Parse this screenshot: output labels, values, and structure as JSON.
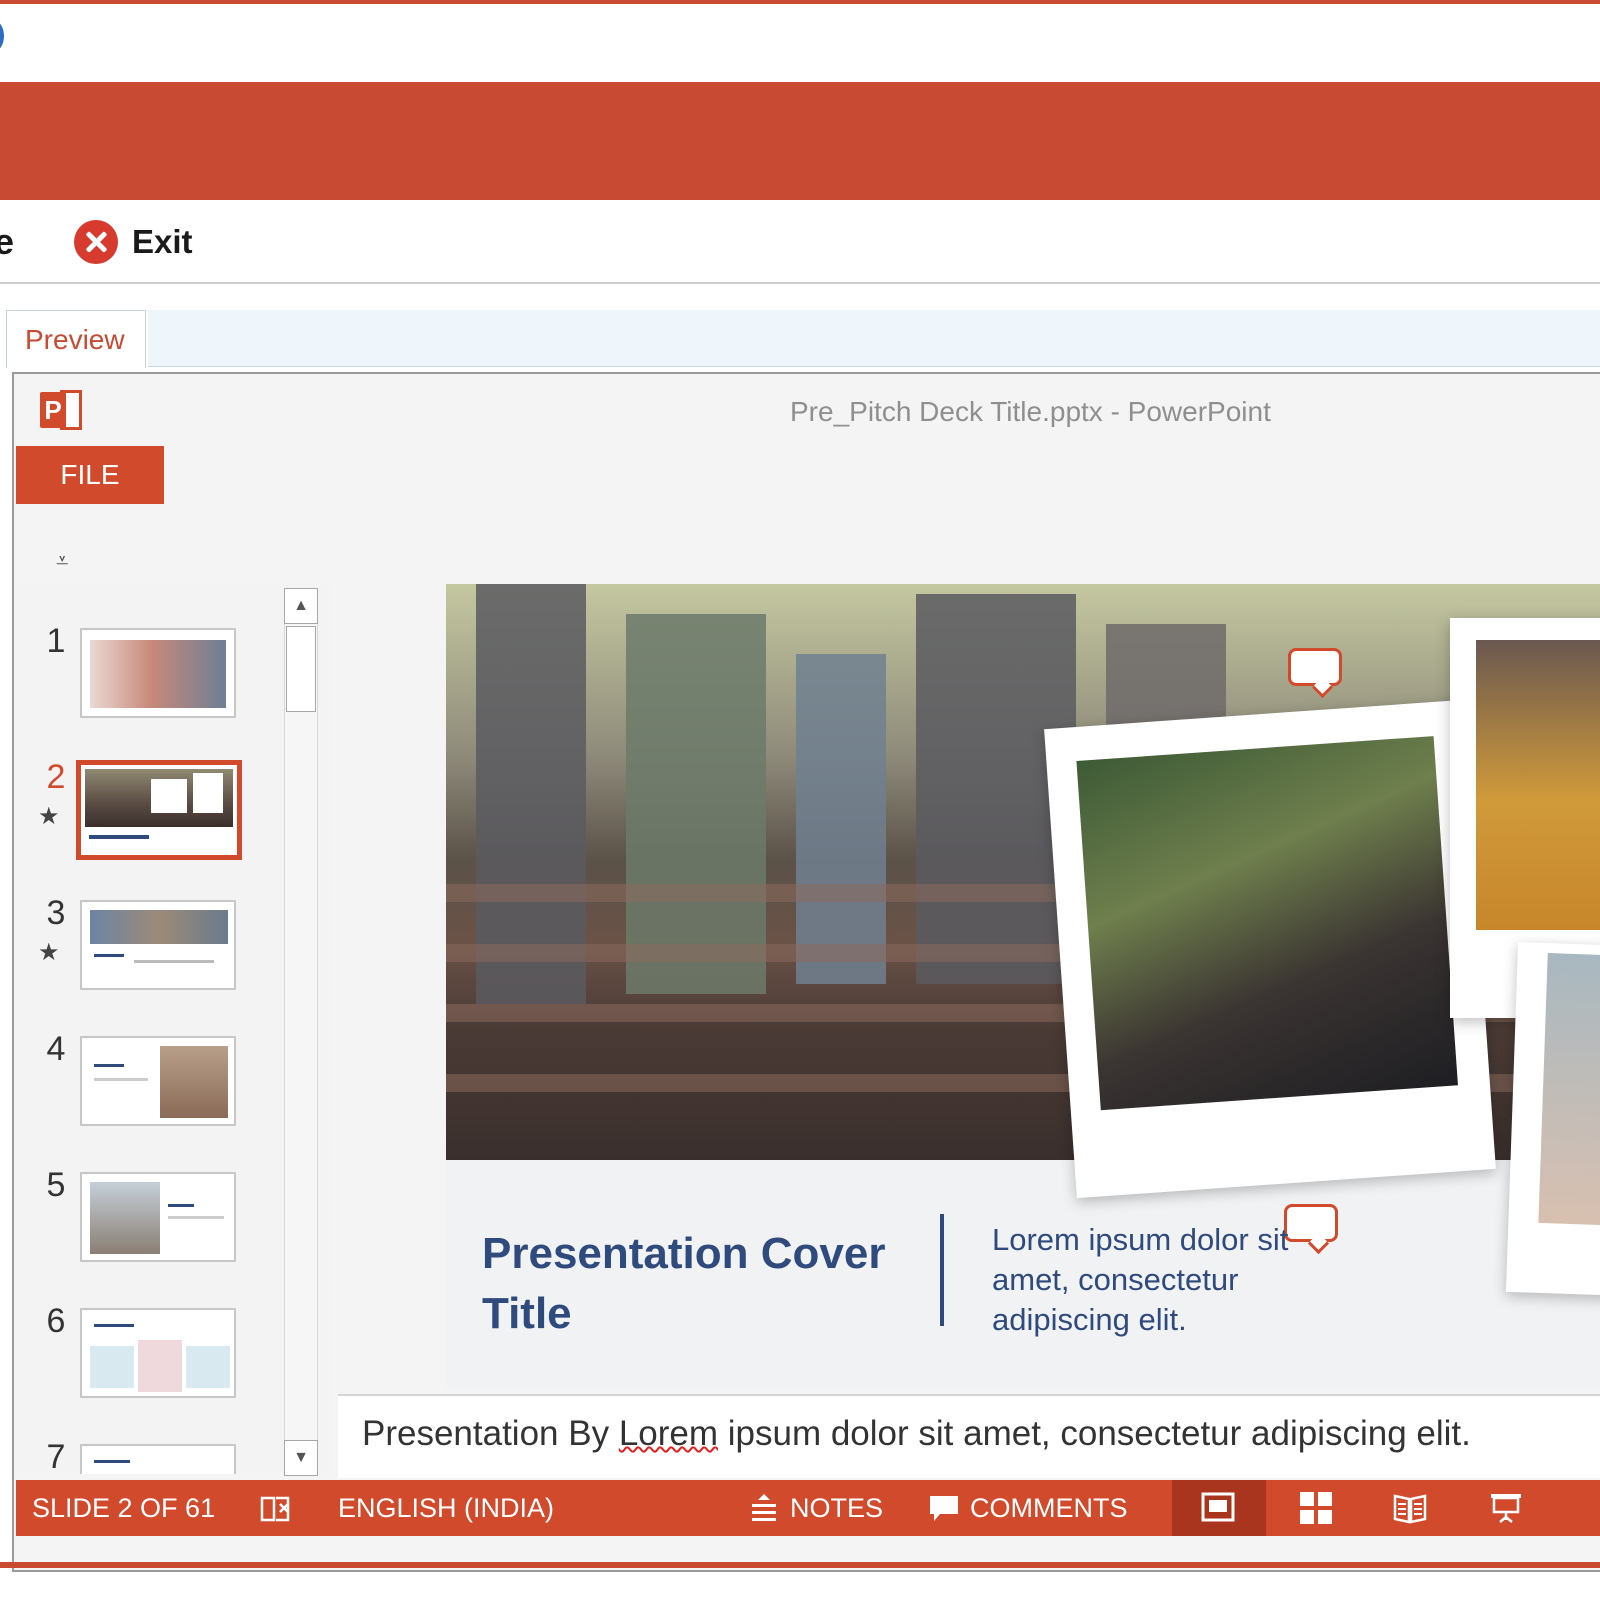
{
  "toolbar": {
    "close_fragment": "e",
    "exit_label": "Exit"
  },
  "tabs": {
    "preview_label": "Preview"
  },
  "window": {
    "title": "Pre_Pitch Deck Title.pptx - PowerPoint",
    "file_tab": "FILE"
  },
  "slides_panel": {
    "thumbnails": [
      {
        "number": "1",
        "star": ""
      },
      {
        "number": "2",
        "star": "★"
      },
      {
        "number": "3",
        "star": "★"
      },
      {
        "number": "4",
        "star": ""
      },
      {
        "number": "5",
        "star": ""
      },
      {
        "number": "6",
        "star": ""
      },
      {
        "number": "7",
        "star": ""
      }
    ],
    "selected": "2"
  },
  "slide": {
    "title": "Presentation Cover Title",
    "subtitle": "Lorem ipsum dolor sit amet, consectetur adipiscing elit."
  },
  "notes": {
    "prefix": "Presentation By ",
    "misspelled": "Lorem",
    "suffix": " ipsum dolor sit amet, consectetur adipiscing elit."
  },
  "statusbar": {
    "slide_counter": "SLIDE 2 OF 61",
    "language": "ENGLISH (INDIA)",
    "notes_label": "NOTES",
    "comments_label": "COMMENTS"
  },
  "colors": {
    "accent": "#c94a33",
    "powerpoint": "#d04a2b",
    "title_blue": "#2f4a7c"
  }
}
